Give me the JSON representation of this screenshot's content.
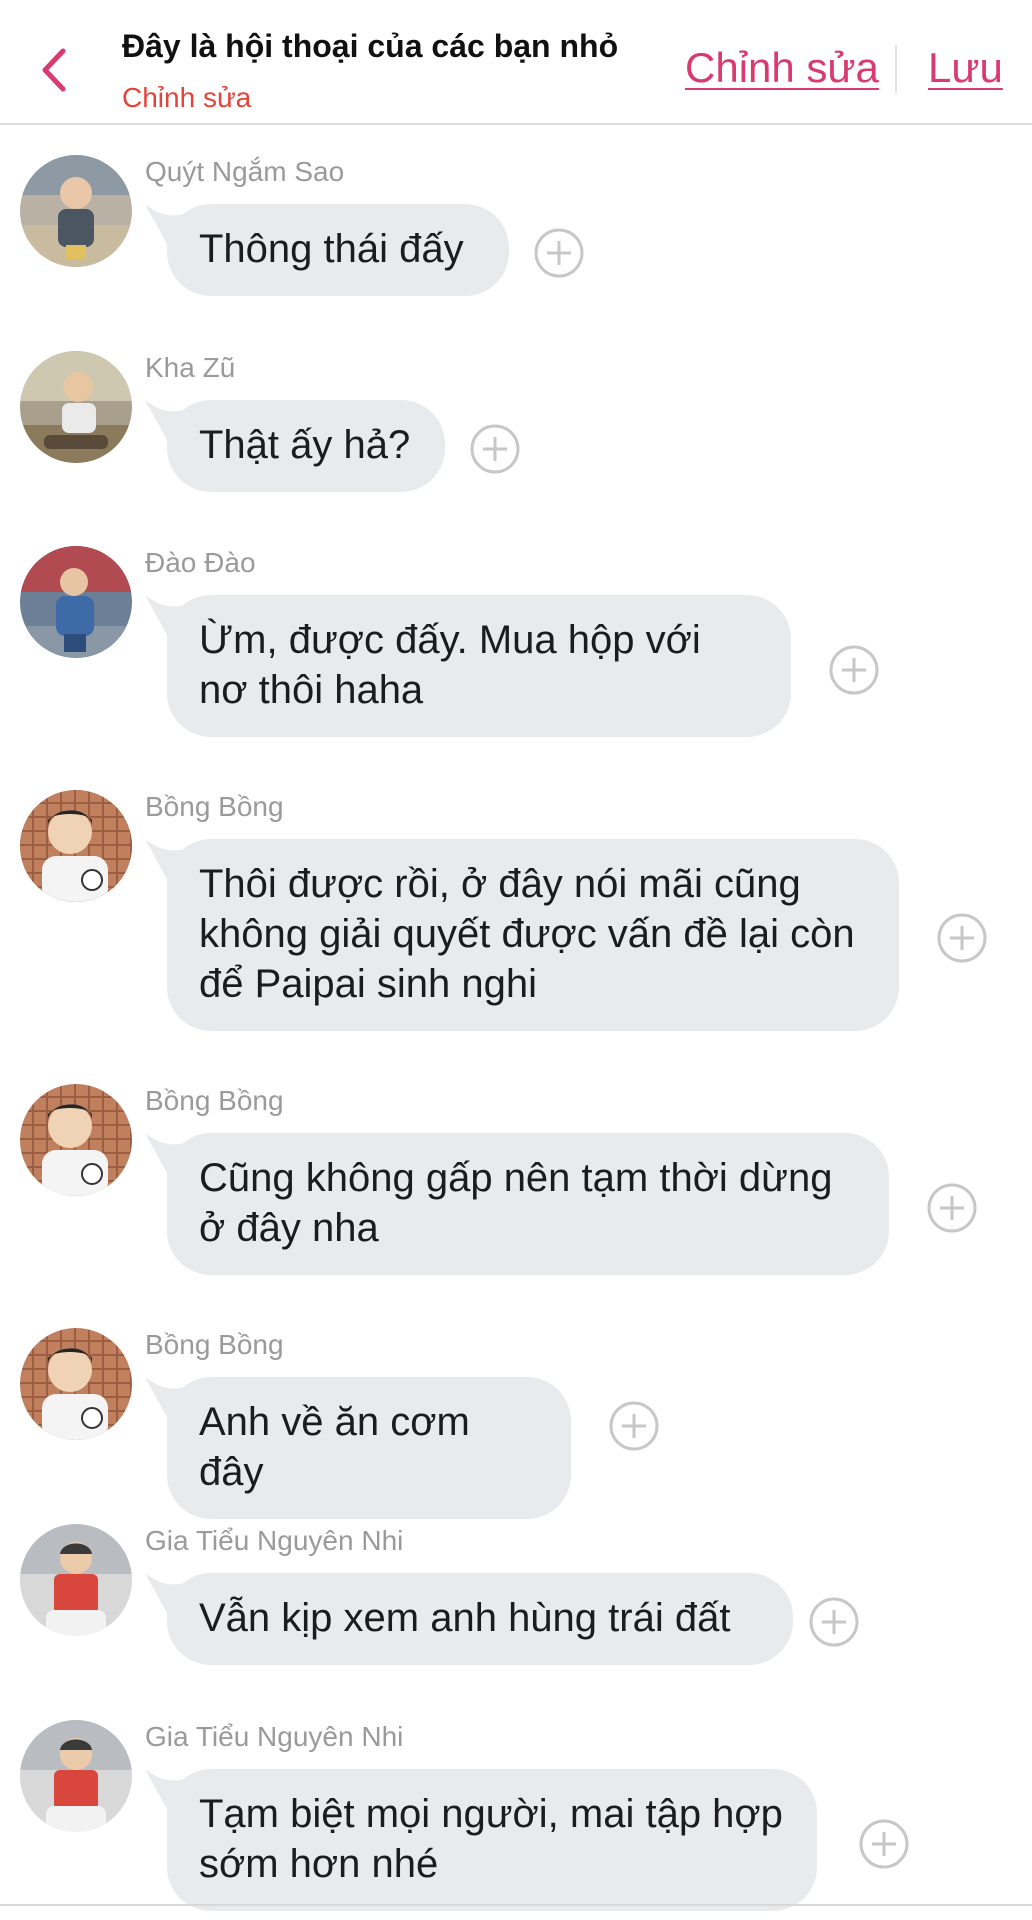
{
  "header": {
    "title": "Đây là hội thoại của các bạn nhỏ",
    "subtitle": "Chỉnh sửa",
    "edit_label": "Chỉnh sửa",
    "save_label": "Lưu",
    "back_icon": "chevron-left-icon",
    "accent_color": "#d93a6f",
    "subtitle_color": "#e5443b"
  },
  "messages": [
    {
      "sender": "Quýt Ngắm Sao",
      "text": "Thông thái đấy"
    },
    {
      "sender": "Kha Zũ",
      "text": "Thật ấy hả?"
    },
    {
      "sender": "Đào Đào",
      "text": "Ừm, được đấy. Mua hộp với nơ thôi haha"
    },
    {
      "sender": "Bồng Bồng",
      "text": "Thôi được rồi, ở đây nói mãi cũng không giải quyết được vấn đề lại còn để Paipai sinh nghi"
    },
    {
      "sender": "Bồng Bồng",
      "text": "Cũng không gấp nên tạm thời dừng ở đây nha"
    },
    {
      "sender": "Bồng Bồng",
      "text": "Anh về ăn cơm đây"
    },
    {
      "sender": "Gia Tiểu Nguyên Nhi",
      "text": "Vẫn kịp xem anh hùng trái đất"
    },
    {
      "sender": "Gia Tiểu Nguyên Nhi",
      "text": "Tạm biệt mọi người, mai tập hợp sớm hơn nhé"
    }
  ],
  "colors": {
    "bubble": "#e9eaec",
    "sender_text": "#9a9a9a",
    "message_text": "#1c1c1c",
    "add_icon": "#c7c7c7"
  },
  "icons": {
    "add": "plus-circle-icon",
    "avatar": "child-photo-avatar"
  }
}
